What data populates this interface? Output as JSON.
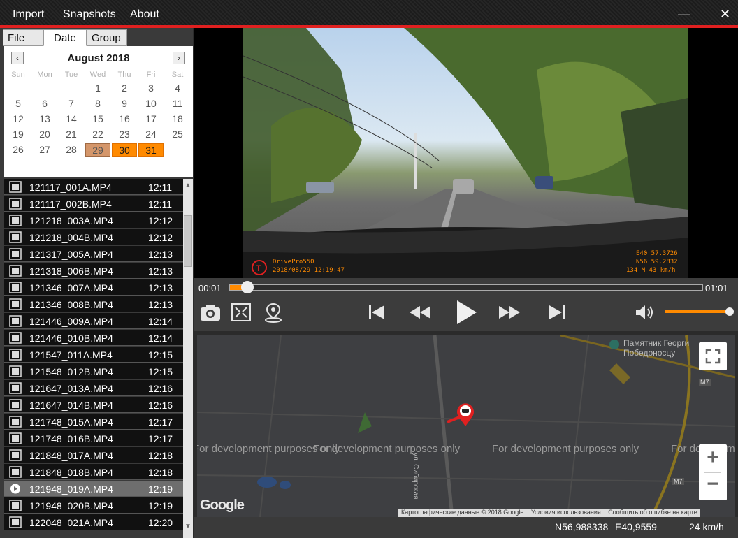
{
  "menu": {
    "import": "Import",
    "snapshots": "Snapshots",
    "about": "About"
  },
  "window": {
    "minimize": "—",
    "close": "✕"
  },
  "tabs": [
    "File",
    "Date",
    "Group"
  ],
  "calendar": {
    "title": "August 2018",
    "prev": "‹",
    "next": "›",
    "dow": [
      "Sun",
      "Mon",
      "Tue",
      "Wed",
      "Thu",
      "Fri",
      "Sat"
    ],
    "days": [
      "1",
      "2",
      "3",
      "4",
      "5",
      "6",
      "7",
      "8",
      "9",
      "10",
      "11",
      "12",
      "13",
      "14",
      "15",
      "16",
      "17",
      "18",
      "19",
      "20",
      "21",
      "22",
      "23",
      "24",
      "25",
      "26",
      "27",
      "28",
      "29",
      "30",
      "31"
    ],
    "selected_day": "29",
    "recorded_days": [
      "30",
      "31"
    ]
  },
  "files": [
    {
      "name": "121117_001A.MP4",
      "time": "12:11"
    },
    {
      "name": "121117_002B.MP4",
      "time": "12:11"
    },
    {
      "name": "121218_003A.MP4",
      "time": "12:12"
    },
    {
      "name": "121218_004B.MP4",
      "time": "12:12"
    },
    {
      "name": "121317_005A.MP4",
      "time": "12:13"
    },
    {
      "name": "121318_006B.MP4",
      "time": "12:13"
    },
    {
      "name": "121346_007A.MP4",
      "time": "12:13"
    },
    {
      "name": "121346_008B.MP4",
      "time": "12:13"
    },
    {
      "name": "121446_009A.MP4",
      "time": "12:14"
    },
    {
      "name": "121446_010B.MP4",
      "time": "12:14"
    },
    {
      "name": "121547_011A.MP4",
      "time": "12:15"
    },
    {
      "name": "121548_012B.MP4",
      "time": "12:15"
    },
    {
      "name": "121647_013A.MP4",
      "time": "12:16"
    },
    {
      "name": "121647_014B.MP4",
      "time": "12:16"
    },
    {
      "name": "121748_015A.MP4",
      "time": "12:17"
    },
    {
      "name": "121748_016B.MP4",
      "time": "12:17"
    },
    {
      "name": "121848_017A.MP4",
      "time": "12:18"
    },
    {
      "name": "121848_018B.MP4",
      "time": "12:18"
    },
    {
      "name": "121948_019A.MP4",
      "time": "12:19"
    },
    {
      "name": "121948_020B.MP4",
      "time": "12:19"
    },
    {
      "name": "122048_021A.MP4",
      "time": "12:20"
    }
  ],
  "playing_file": "121948_019A.MP4",
  "osd": {
    "brand": "DrivePro550",
    "datetime": "2018/08/29 12:19:47",
    "lon": "E40 57.3726",
    "lat": "N56 59.2832",
    "altspeed": "134 M   43 km/h"
  },
  "player": {
    "time_current": "00:01",
    "time_total": "01:01",
    "progress": 0.03,
    "volume": 0.95
  },
  "map": {
    "dev_notice": "For development purposes only",
    "landmark": "Памятник Георги Победоносцу",
    "street": "ул. Сибирская",
    "road_badge": "M7",
    "logo": "Google",
    "attribution": [
      "Картографические данные © 2018 Google",
      "Условия использования",
      "Сообщить об ошибке на карте"
    ],
    "zoom_in": "+",
    "zoom_out": "−"
  },
  "status": {
    "lat": "N56,988338",
    "lon": "E40,9559",
    "speed": "24 km/h"
  },
  "colors": {
    "accent": "#ff8a00",
    "titlebar_rule": "#e02020"
  }
}
